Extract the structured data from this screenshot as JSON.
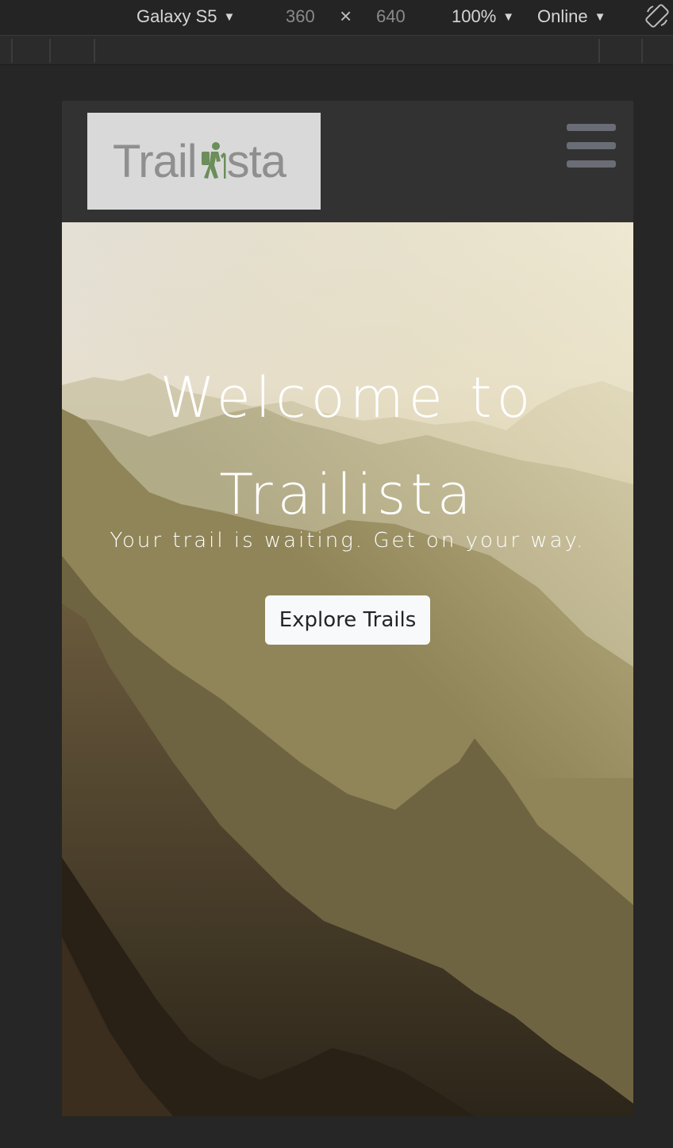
{
  "devtools": {
    "device": "Galaxy S5",
    "width": "360",
    "times": "×",
    "height": "640",
    "zoom": "100%",
    "network": "Online",
    "caret": "▼"
  },
  "navbar": {
    "logo": {
      "pre": "Trail",
      "icon": "hiker-icon",
      "post": "sta",
      "icon_color": "#6b8e5a"
    },
    "menu_icon": "hamburger-icon"
  },
  "hero": {
    "title_line1": "Welcome to",
    "title_line2": "Trailista",
    "subtitle": "Your trail is waiting. Get on your way.",
    "cta_label": "Explore Trails"
  },
  "colors": {
    "toolbar_bg": "#242424",
    "navbar_bg": "#323232",
    "logo_bg": "#d9d9d9",
    "button_bg": "#f8f9fa"
  }
}
